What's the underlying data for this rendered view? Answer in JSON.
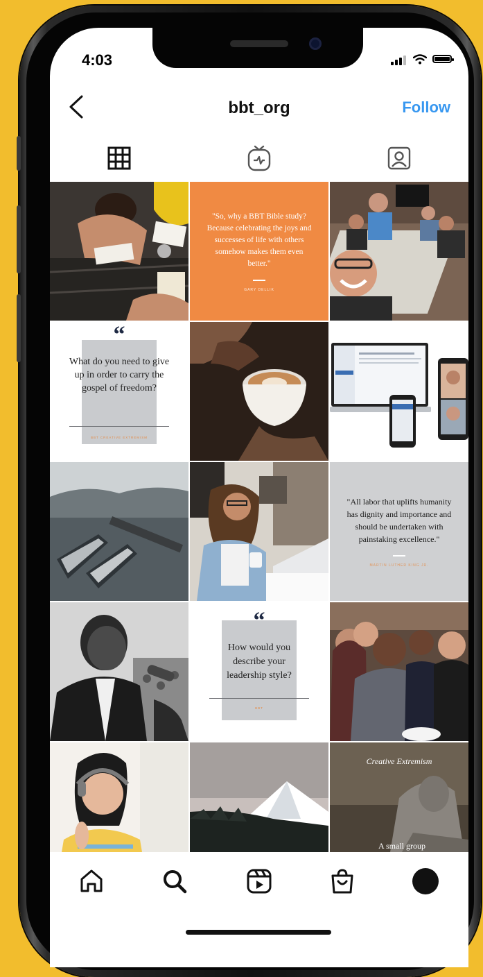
{
  "status": {
    "time": "4:03"
  },
  "header": {
    "back_icon": "chevron-left-icon",
    "title": "bbt_org",
    "follow_label": "Follow"
  },
  "tabs": [
    {
      "icon": "grid-icon",
      "active": true
    },
    {
      "icon": "igtv-icon",
      "active": false
    },
    {
      "icon": "tagged-icon",
      "active": false
    }
  ],
  "posts": {
    "p1_quote": "\"So, why a BBT Bible study? Because celebrating the joys and successes of life with others somehow makes them even better.\"",
    "p1_attr": "GARY DELLIK",
    "p2_quote": "What do you need to give up in order to carry the gospel of freedom?",
    "p2_attr": "BBT CREATIVE EXTREMISM",
    "p3_quote": "\"All labor that uplifts humanity has dignity and importance and should be undertaken with painstaking excellence.\"",
    "p3_attr": "MARTIN LUTHER KING JR.",
    "p4_quote": "How would you describe your leadership style?",
    "p4_attr": "BBT",
    "p5_caption_top": "Creative Extremism",
    "p5_caption_bottom": "A small group"
  },
  "bottom_nav": [
    {
      "icon": "home-icon"
    },
    {
      "icon": "search-icon"
    },
    {
      "icon": "reels-icon"
    },
    {
      "icon": "shop-icon"
    },
    {
      "icon": "profile-avatar"
    }
  ],
  "colors": {
    "follow": "#3797f0",
    "accent_orange": "#f08a43",
    "background": "#f2bd2d"
  }
}
